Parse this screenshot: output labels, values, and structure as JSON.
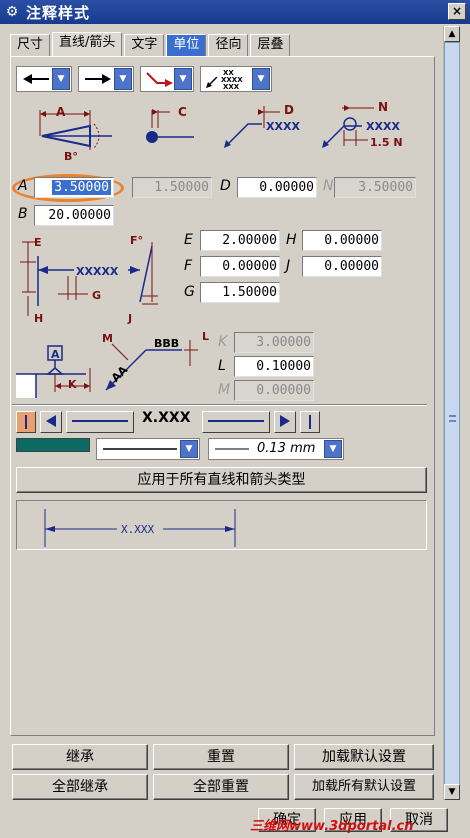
{
  "window": {
    "title": "注释样式",
    "close": "×"
  },
  "tabs": [
    {
      "label": "尺寸"
    },
    {
      "label": "直线/箭头"
    },
    {
      "label": "文字"
    },
    {
      "label": "单位"
    },
    {
      "label": "径向"
    },
    {
      "label": "层叠"
    }
  ],
  "diagram_labels": {
    "a": "A",
    "b": "B°",
    "c": "C",
    "d": "D",
    "xxxx": "XXXX",
    "n": "N",
    "xxxx2": "XXXX",
    "n15": "1.5 N",
    "e": "E",
    "xxxxx": "XXXXX",
    "g": "G",
    "h": "H",
    "f": "F°",
    "j": "J",
    "k": "K",
    "m": "M",
    "aa": "AA",
    "bbb": "BBB",
    "l": "L",
    "datum": "A",
    "xx": "XX",
    "xxxx_small": "XXXX",
    "xxx_small": "XXX"
  },
  "fields": {
    "A": {
      "label": "A",
      "value": "3.50000"
    },
    "B": {
      "label": "B",
      "value": "20.00000"
    },
    "C": {
      "value": "1.50000"
    },
    "D": {
      "label": "D",
      "value": "0.00000"
    },
    "N": {
      "label": "N",
      "value": "3.50000"
    },
    "E": {
      "label": "E",
      "value": "2.00000"
    },
    "F": {
      "label": "F",
      "value": "0.00000"
    },
    "G": {
      "label": "G",
      "value": "1.50000"
    },
    "H": {
      "label": "H",
      "value": "0.00000"
    },
    "J": {
      "label": "J",
      "value": "0.00000"
    },
    "K": {
      "label": "K",
      "value": "3.00000"
    },
    "L": {
      "label": "L",
      "value": "0.10000"
    },
    "M": {
      "label": "M",
      "value": "0.00000"
    }
  },
  "line_row": {
    "placeholder_text": "X.XXX"
  },
  "line_style": {
    "width_label": "0.13 mm",
    "color": "#0b6a64"
  },
  "buttons": {
    "apply_all": "应用于所有直线和箭头类型",
    "inherit": "继承",
    "reset": "重置",
    "load_default": "加载默认设置",
    "inherit_all": "全部继承",
    "reset_all": "全部重置",
    "load_all_default": "加载所有默认设置",
    "ok": "确定",
    "apply": "应用",
    "cancel": "取消"
  },
  "preview": {
    "text": "X.XXX"
  },
  "watermark": "三维网www.3dportal.cn"
}
